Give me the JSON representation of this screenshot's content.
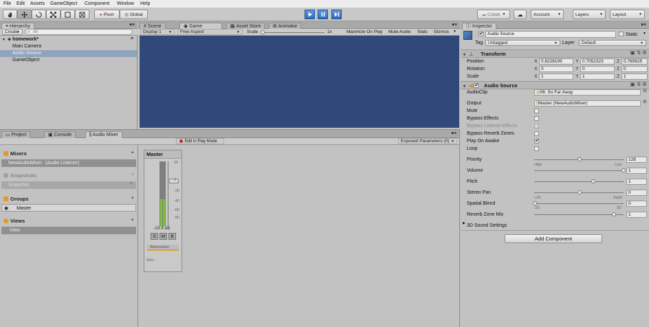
{
  "menu": [
    "File",
    "Edit",
    "Assets",
    "GameObject",
    "Component",
    "Window",
    "Help"
  ],
  "toolbar": {
    "pivot": "Pivot",
    "global": "Global",
    "collab": "Collab",
    "account": "Account",
    "layers": "Layers",
    "layout": "Layout"
  },
  "hierarchy": {
    "tab": "Hierarchy",
    "create": "Create",
    "search_placeholder": "All",
    "scene": "homework*",
    "items": [
      "Main Camera",
      "Audio Source",
      "GameObject"
    ]
  },
  "game": {
    "tabs": [
      "Scene",
      "Game",
      "Asset Store",
      "Animator"
    ],
    "display": "Display 1",
    "aspect": "Free Aspect",
    "scale_label": "Scale",
    "scale_value": "1x",
    "toggles": [
      "Maximize On Play",
      "Mute Audio",
      "Stats",
      "Gizmos"
    ]
  },
  "bottom": {
    "tabs": [
      "Project",
      "Console",
      "Audio Mixer"
    ],
    "edit_play_mode": "Edit in Play Mode",
    "exposed_params": "Exposed Parameters (0)"
  },
  "mixer": {
    "mixers_title": "Mixers",
    "mixer_item": "NewAudioMixer",
    "mixer_item_note": "(Audio Listener)",
    "snapshots_title": "Snapshots",
    "snapshot_item": "Snapshot",
    "groups_title": "Groups",
    "group_item": "Master",
    "views_title": "Views",
    "view_item": "View",
    "strip_name": "Master",
    "db_value": "-19.4 dB",
    "scale_marks": [
      "20",
      "0",
      "-20",
      "-40",
      "-60",
      "-80"
    ],
    "btn_s": "S",
    "btn_m": "M",
    "btn_b": "B",
    "attenuation": "Attenuation",
    "add": "Add..."
  },
  "inspector": {
    "tab": "Inspector",
    "object_name": "Audio Source",
    "static_label": "Static",
    "tag_label": "Tag",
    "tag_value": "Untagged",
    "layer_label": "Layer",
    "layer_value": "Default",
    "transform": {
      "title": "Transform",
      "position_label": "Position",
      "position": [
        "0.8228109",
        "0.7052323",
        "0.765625"
      ],
      "rotation_label": "Rotation",
      "rotation": [
        "0",
        "0",
        "0"
      ],
      "scale_label": "Scale",
      "scale": [
        "1",
        "1",
        "1"
      ]
    },
    "audio": {
      "title": "Audio Source",
      "clip_label": "AudioClip",
      "clip_value": "06. So Far Away",
      "output_label": "Output",
      "output_value": "Master (NewAudioMixer)",
      "mute_label": "Mute",
      "bypass_effects_label": "Bypass Effects",
      "bypass_listener_label": "Bypass Listener Effects",
      "bypass_reverb_label": "Bypass Reverb Zones",
      "play_on_awake_label": "Play On Awake",
      "loop_label": "Loop",
      "priority_label": "Priority",
      "priority_value": "128",
      "priority_high": "High",
      "priority_low": "Low",
      "volume_label": "Volume",
      "volume_value": "1",
      "pitch_label": "Pitch",
      "pitch_value": "1",
      "stereo_label": "Stereo Pan",
      "stereo_value": "0",
      "stereo_left": "Left",
      "stereo_right": "Right",
      "spatial_label": "Spatial Blend",
      "spatial_value": "0",
      "spatial_2d": "2D",
      "spatial_3d": "3D",
      "reverb_label": "Reverb Zone Mix",
      "reverb_value": "1",
      "settings3d": "3D Sound Settings",
      "play_on_awake_checked": true
    },
    "add_component": "Add Component"
  },
  "colors": {
    "game_view": "#31497a",
    "play_active": "#3d7ad0",
    "selection": "#8fa3be",
    "meter_green": "#7fbf3a"
  }
}
